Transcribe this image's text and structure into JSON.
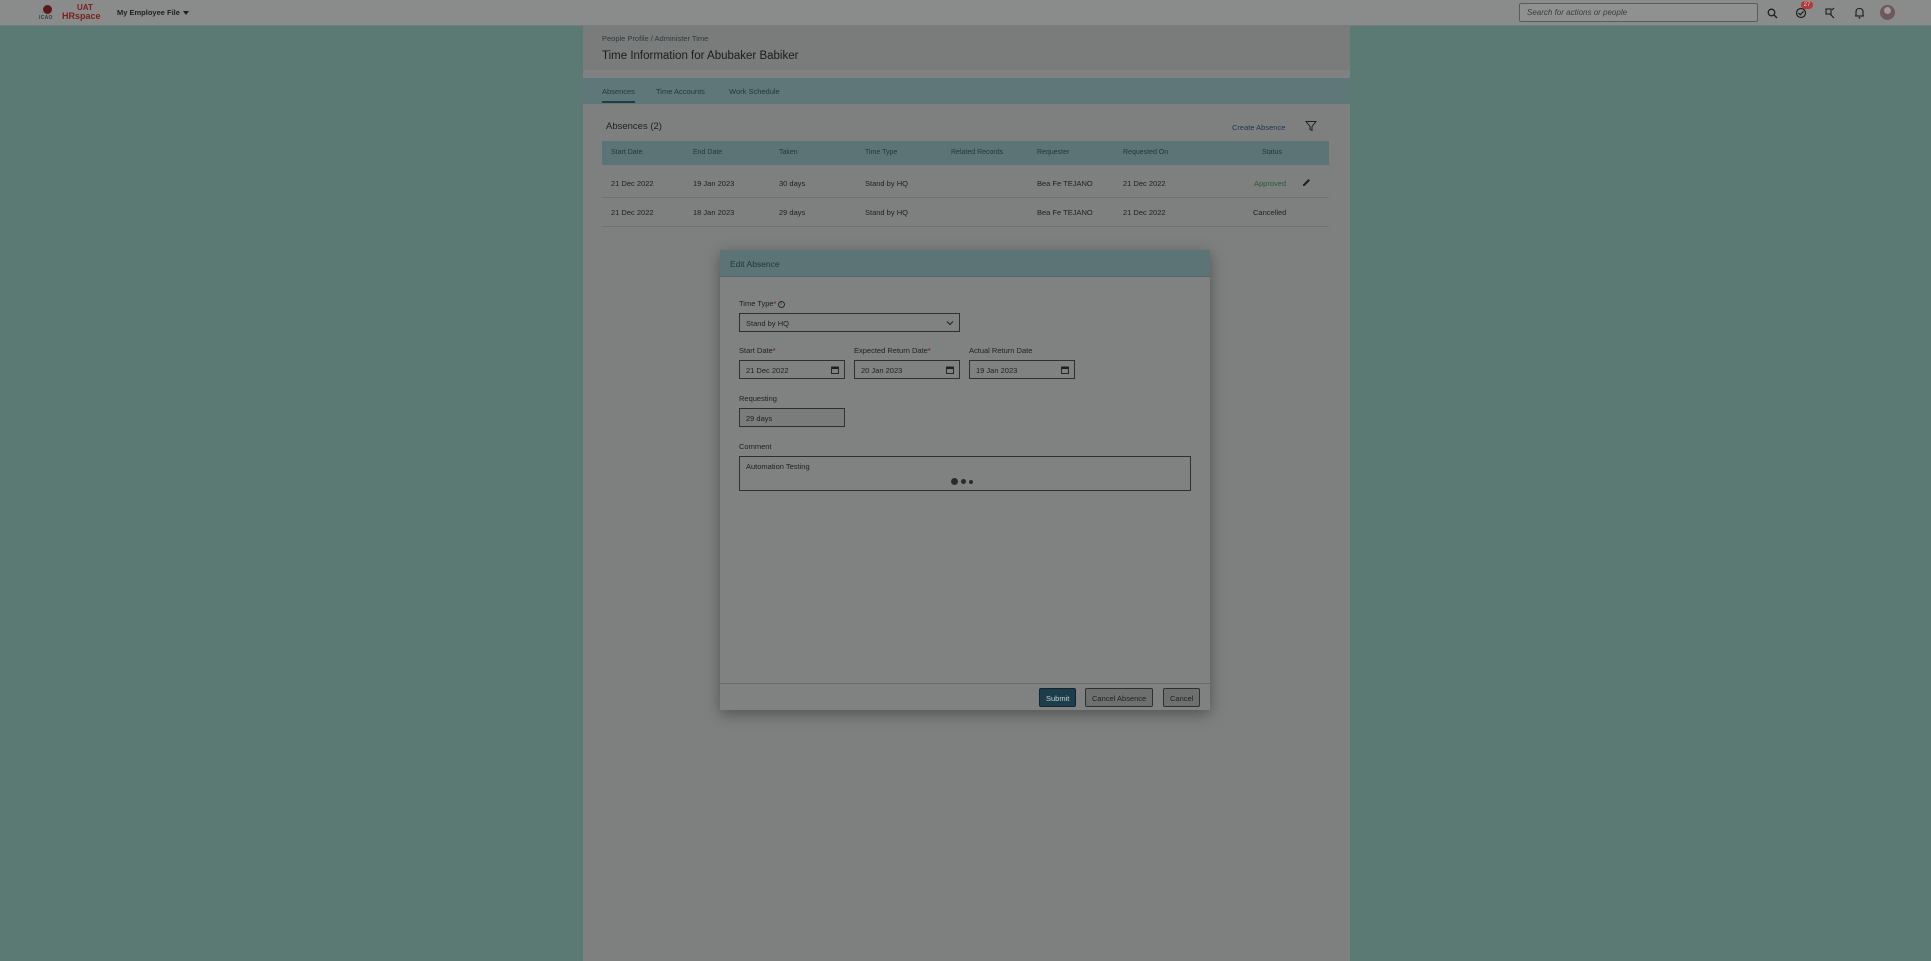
{
  "shell": {
    "logo_left": "ICAO",
    "logo_uat": "UAT",
    "logo_hr": "HRspace",
    "menu_label": "My Employee File",
    "search_placeholder": "Search for actions or people",
    "badge_count": "27",
    "icons": [
      "search-icon",
      "approvals-icon",
      "tools-icon",
      "bell-icon"
    ]
  },
  "page": {
    "breadcrumb": "People Profile / Administer Time",
    "title": "Time Information for Abubaker Babiker",
    "tabs": [
      "Absences",
      "Time Accounts",
      "Work Schedule"
    ],
    "active_tab": "Absences"
  },
  "absences": {
    "title": "Absences (2)",
    "create_label": "Create Absence",
    "columns": [
      "Start Date",
      "End Date",
      "Taken",
      "Time Type",
      "Related Records",
      "Requester",
      "Requested On",
      "Status"
    ],
    "rows": [
      {
        "start": "21 Dec 2022",
        "end": "19 Jan 2023",
        "taken": "30 days",
        "type": "Stand by HQ",
        "related": "",
        "requester": "Bea Fe TEJANO",
        "requested_on": "21 Dec 2022",
        "status": "Approved"
      },
      {
        "start": "21 Dec 2022",
        "end": "18 Jan 2023",
        "taken": "29 days",
        "type": "Stand by HQ",
        "related": "",
        "requester": "Bea Fe TEJANO",
        "requested_on": "21 Dec 2022",
        "status": "Cancelled"
      }
    ]
  },
  "dialog": {
    "title": "Edit Absence",
    "time_type_label": "Time Type",
    "time_type_value": "Stand by HQ",
    "start_date_label": "Start Date",
    "start_date_value": "21 Dec 2022",
    "expected_return_label": "Expected Return Date",
    "expected_return_value": "20 Jan 2023",
    "actual_return_label": "Actual Return Date",
    "actual_return_value": "19 Jan 2023",
    "requesting_label": "Requesting",
    "requesting_value": "29 days",
    "comment_label": "Comment",
    "comment_value": "Automation Testing",
    "submit_label": "Submit",
    "cancel_absence_label": "Cancel Absence",
    "cancel_label": "Cancel"
  },
  "colors": {
    "backdrop": "#5c7a74",
    "header_teal": "#5c7476",
    "primary_button": "#1d3d4d",
    "brand_red": "#7a1e1e"
  }
}
